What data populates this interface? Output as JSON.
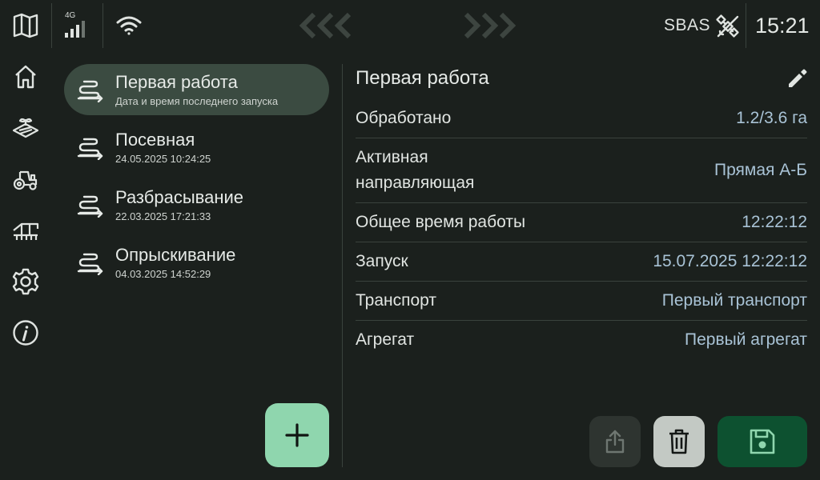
{
  "status_bar": {
    "network_label": "4G",
    "correction_label": "SBAS",
    "time": "15:21"
  },
  "sidebar": {
    "items": [
      {
        "name": "map-icon",
        "interactable": true
      },
      {
        "name": "home-icon",
        "interactable": true
      },
      {
        "name": "field-icon",
        "interactable": true
      },
      {
        "name": "tractor-icon",
        "interactable": true
      },
      {
        "name": "implement-icon",
        "interactable": true
      },
      {
        "name": "settings-icon",
        "interactable": true
      },
      {
        "name": "info-icon",
        "interactable": true
      }
    ]
  },
  "jobs": [
    {
      "title": "Первая работа",
      "subtitle": "Дата и время последнего запуска",
      "active": true
    },
    {
      "title": "Посевная",
      "subtitle": "24.05.2025 10:24:25",
      "active": false
    },
    {
      "title": "Разбрасывание",
      "subtitle": "22.03.2025 17:21:33",
      "active": false
    },
    {
      "title": "Опрыскивание",
      "subtitle": "04.03.2025 14:52:29",
      "active": false
    }
  ],
  "details": {
    "title": "Первая работа",
    "rows": [
      {
        "label": "Обработано",
        "value": "1.2/3.6 га"
      },
      {
        "label": "Активная направляющая",
        "label_line1": "Активная",
        "label_line2": "направляющая",
        "value": "Прямая А-Б"
      },
      {
        "label": "Общее время работы",
        "value": "12:22:12"
      },
      {
        "label": "Запуск",
        "value": "15.07.2025 12:22:12"
      },
      {
        "label": "Транспорт",
        "value": "Первый транспорт"
      },
      {
        "label": "Агрегат",
        "value": "Первый агрегат"
      }
    ]
  },
  "colors": {
    "background": "#1b201d",
    "active_item": "#3b4b41",
    "fab": "#8fd6ae",
    "value_text": "#a9c3d6",
    "save_button": "#0d5130",
    "save_icon": "#8fd6ae",
    "delete_button": "#c3c9c4"
  }
}
